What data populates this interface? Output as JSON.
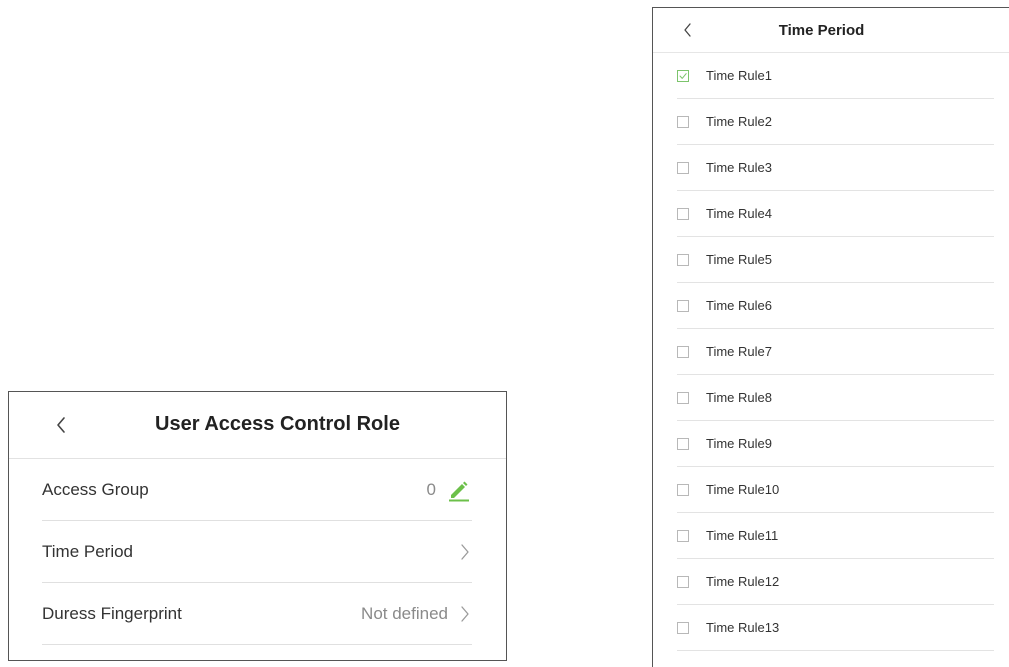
{
  "left_panel": {
    "title": "User Access Control Role",
    "back_icon": "chevron-left-icon",
    "rows": [
      {
        "label": "Access Group",
        "value": "0",
        "action_icon": "pencil-icon"
      },
      {
        "label": "Time Period",
        "value": "",
        "action_icon": "chevron-right-icon"
      },
      {
        "label": "Duress Fingerprint",
        "value": "Not defined",
        "action_icon": "chevron-right-icon"
      }
    ]
  },
  "right_panel": {
    "title": "Time Period",
    "back_icon": "chevron-left-icon",
    "items": [
      {
        "label": "Time Rule1",
        "checked": true
      },
      {
        "label": "Time Rule2",
        "checked": false
      },
      {
        "label": "Time Rule3",
        "checked": false
      },
      {
        "label": "Time Rule4",
        "checked": false
      },
      {
        "label": "Time Rule5",
        "checked": false
      },
      {
        "label": "Time Rule6",
        "checked": false
      },
      {
        "label": "Time Rule7",
        "checked": false
      },
      {
        "label": "Time Rule8",
        "checked": false
      },
      {
        "label": "Time Rule9",
        "checked": false
      },
      {
        "label": "Time Rule10",
        "checked": false
      },
      {
        "label": "Time Rule11",
        "checked": false
      },
      {
        "label": "Time Rule12",
        "checked": false
      },
      {
        "label": "Time Rule13",
        "checked": false
      }
    ]
  },
  "colors": {
    "accent": "#6cc04a",
    "checkbox_checked_border": "#7cc46c",
    "divider": "#e3e3e3",
    "muted_text": "#8a8a8a"
  }
}
